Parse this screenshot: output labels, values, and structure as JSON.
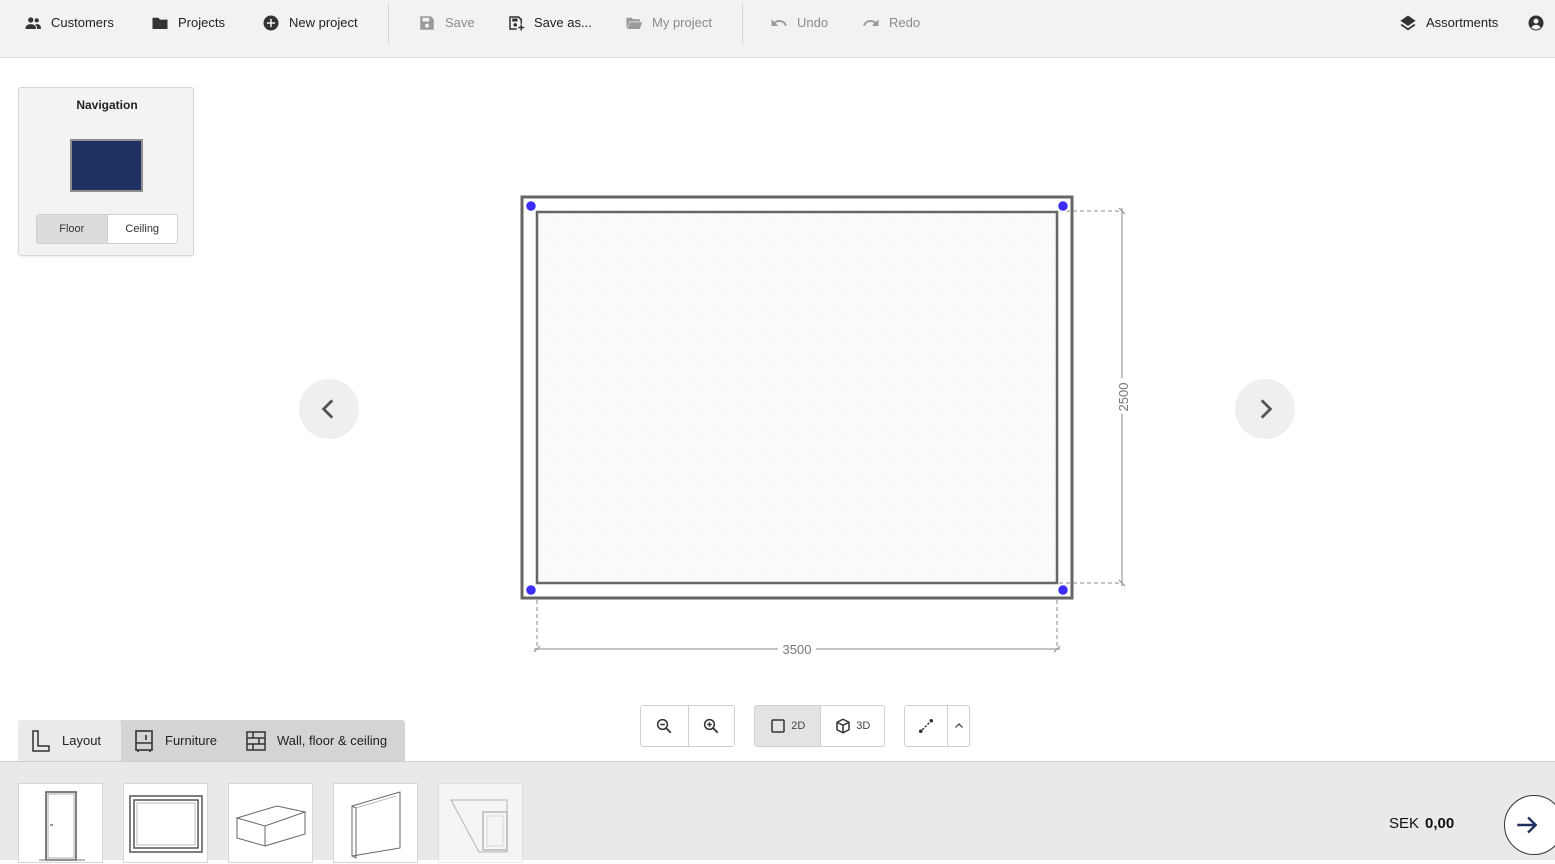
{
  "toolbar": {
    "customers": "Customers",
    "projects": "Projects",
    "new_project": "New project",
    "save": "Save",
    "save_as": "Save as...",
    "my_project": "My project",
    "undo": "Undo",
    "redo": "Redo",
    "assortments": "Assortments"
  },
  "navigation": {
    "title": "Navigation",
    "floor": "Floor",
    "ceiling": "Ceiling",
    "selected": "Floor",
    "thumb_color": "#1f3163"
  },
  "room": {
    "width_label": "3500",
    "depth_label": "2500",
    "handle_color": "#3b2dff"
  },
  "view": {
    "mode_2d": "2D",
    "mode_3d": "3D",
    "selected": "2D"
  },
  "categories": {
    "layout": "Layout",
    "furniture": "Furniture",
    "wall_floor_ceiling": "Wall, floor & ceiling",
    "selected": "Layout"
  },
  "tray": {
    "items": [
      "door",
      "window",
      "box",
      "wall-panel",
      "niche"
    ]
  },
  "footer": {
    "currency": "SEK",
    "amount": "0,00"
  }
}
